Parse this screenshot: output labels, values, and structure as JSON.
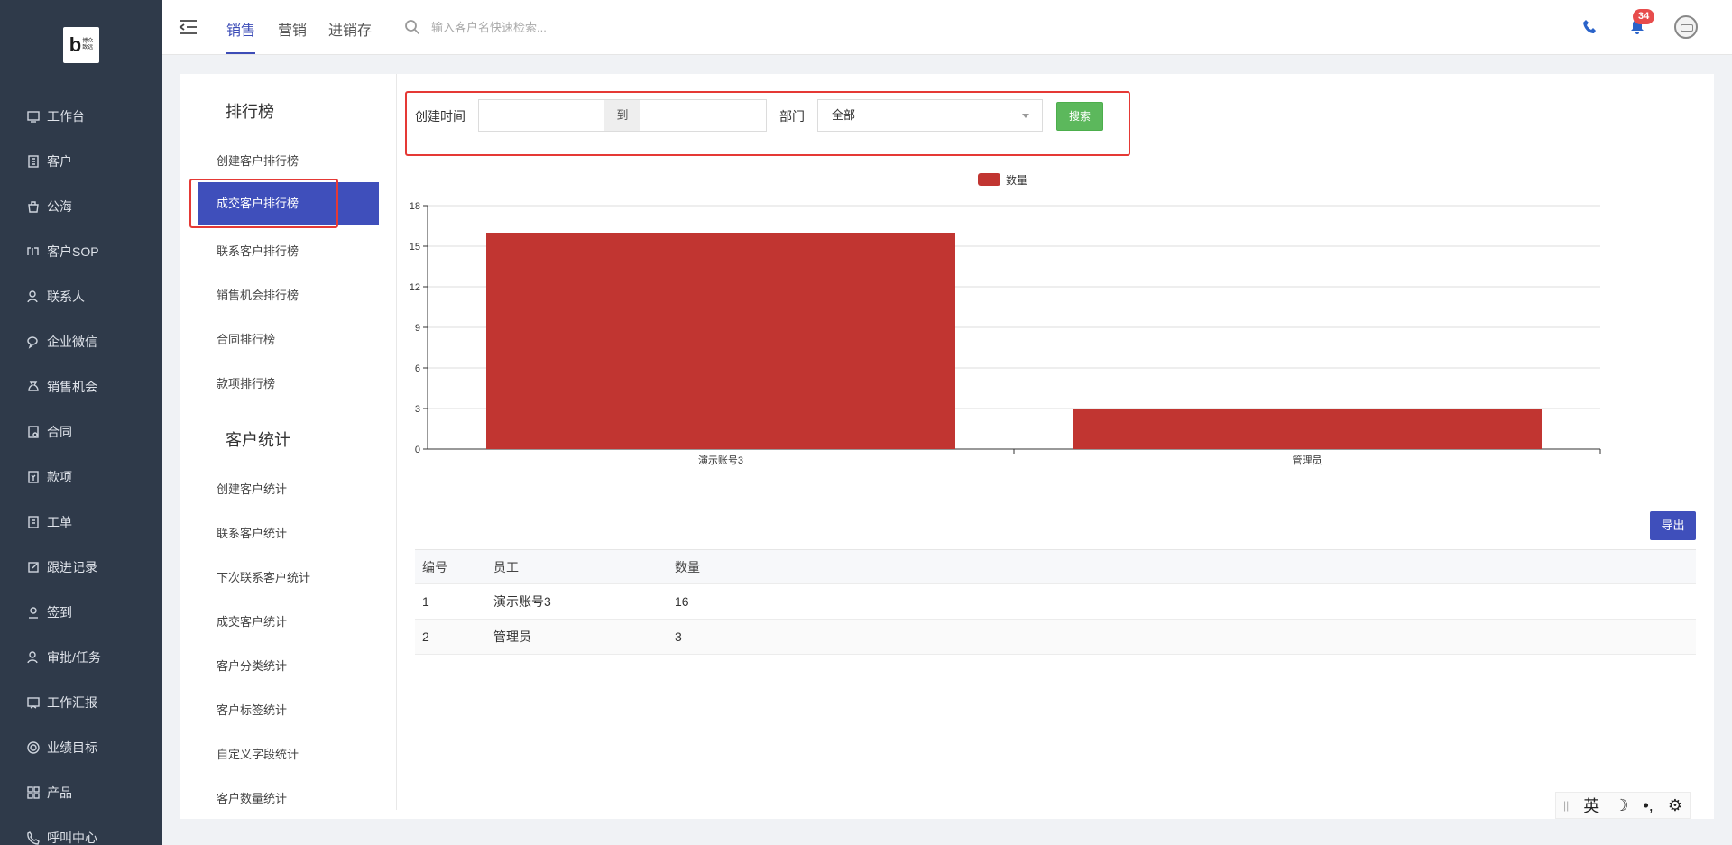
{
  "sidebar": {
    "logo_mark": "b",
    "logo_text": "博众致远",
    "items": [
      {
        "label": "工作台",
        "icon": "workbench-icon"
      },
      {
        "label": "客户",
        "icon": "customer-icon"
      },
      {
        "label": "公海",
        "icon": "public-sea-icon"
      },
      {
        "label": "客户SOP",
        "icon": "sop-icon"
      },
      {
        "label": "联系人",
        "icon": "contact-icon"
      },
      {
        "label": "企业微信",
        "icon": "wechat-icon"
      },
      {
        "label": "销售机会",
        "icon": "money-bag-icon"
      },
      {
        "label": "合同",
        "icon": "contract-icon"
      },
      {
        "label": "款项",
        "icon": "payment-icon"
      },
      {
        "label": "工单",
        "icon": "ticket-icon"
      },
      {
        "label": "跟进记录",
        "icon": "edit-icon"
      },
      {
        "label": "签到",
        "icon": "checkin-icon"
      },
      {
        "label": "审批/任务",
        "icon": "approval-icon"
      },
      {
        "label": "工作汇报",
        "icon": "report-icon"
      },
      {
        "label": "业绩目标",
        "icon": "target-icon"
      },
      {
        "label": "产品",
        "icon": "product-icon"
      },
      {
        "label": "呼叫中心",
        "icon": "call-center-icon"
      }
    ]
  },
  "topbar": {
    "tabs": [
      "销售",
      "营销",
      "进销存"
    ],
    "active_tab": "销售",
    "search_placeholder": "输入客户名快速检索...",
    "notification_count": "34"
  },
  "subnav": {
    "section1_title": "排行榜",
    "section1_items": [
      "创建客户排行榜",
      "成交客户排行榜",
      "联系客户排行榜",
      "销售机会排行榜",
      "合同排行榜",
      "款项排行榜"
    ],
    "active_item": "成交客户排行榜",
    "section2_title": "客户统计",
    "section2_items": [
      "创建客户统计",
      "联系客户统计",
      "下次联系客户统计",
      "成交客户统计",
      "客户分类统计",
      "客户标签统计",
      "自定义字段统计",
      "客户数量统计"
    ]
  },
  "filter": {
    "created_time_label": "创建时间",
    "date_from": "",
    "date_to": "",
    "separator": "到",
    "dept_label": "部门",
    "dept_value": "全部",
    "search_button": "搜索"
  },
  "chart_data": {
    "type": "bar",
    "categories": [
      "演示账号3",
      "管理员"
    ],
    "series": [
      {
        "name": "数量",
        "values": [
          16,
          3
        ],
        "color": "#c13531"
      }
    ],
    "ylim": [
      0,
      18
    ],
    "yticks": [
      0,
      3,
      6,
      9,
      12,
      15,
      18
    ],
    "grid": true,
    "legend": "top-center"
  },
  "export_button": "导出",
  "table": {
    "headers": [
      "编号",
      "员工",
      "数量"
    ],
    "rows": [
      [
        "1",
        "演示账号3",
        "16"
      ],
      [
        "2",
        "管理员",
        "3"
      ]
    ]
  },
  "ime": {
    "lang": "英"
  },
  "colors": {
    "sidebar_bg": "#2f3a4a",
    "accent": "#3f4fbb",
    "bar": "#c13531",
    "search_green": "#5cb85c",
    "highlight_red": "#e53935"
  }
}
